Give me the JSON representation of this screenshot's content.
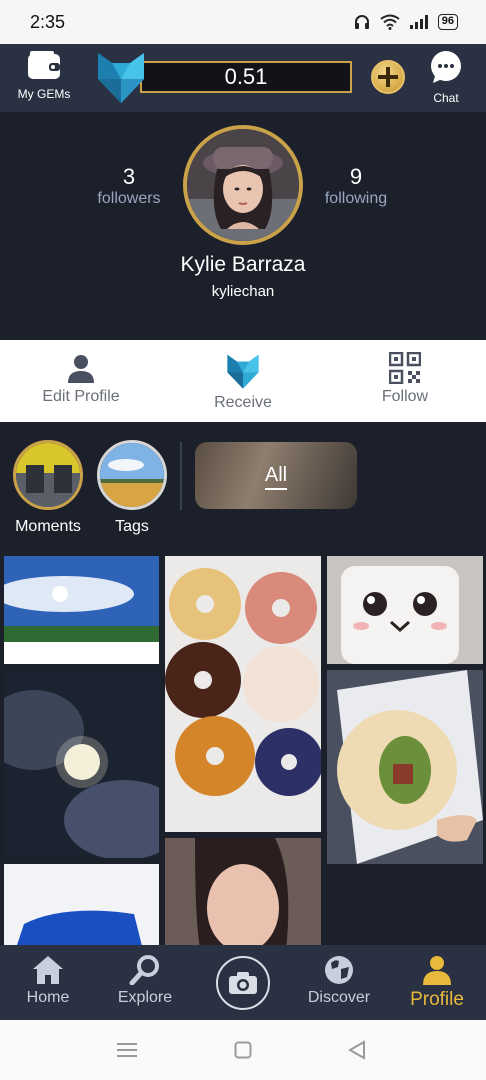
{
  "status_bar": {
    "time": "2:35",
    "battery": "96"
  },
  "top_bar": {
    "wallet_label": "My GEMs",
    "gem_balance": "0.51",
    "chat_label": "Chat",
    "accent": "#c9a24a"
  },
  "profile": {
    "followers_count": "3",
    "followers_label": "followers",
    "following_count": "9",
    "following_label": "following",
    "name": "Kylie Barraza",
    "username": "kyliechan"
  },
  "actions": {
    "edit_profile": "Edit Profile",
    "receive": "Receive",
    "follow": "Follow"
  },
  "collections": {
    "moments": "Moments",
    "tags": "Tags",
    "all": "All"
  },
  "bottom_nav": {
    "home": "Home",
    "explore": "Explore",
    "discover": "Discover",
    "profile": "Profile",
    "active_color": "#e9b93c"
  }
}
